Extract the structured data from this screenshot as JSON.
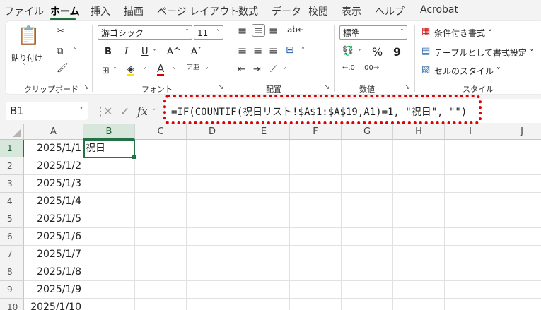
{
  "menu_tabs": [
    "ファイル",
    "ホーム",
    "挿入",
    "描画",
    "ページ レイアウト",
    "数式",
    "データ",
    "校閲",
    "表示",
    "ヘルプ",
    "Acrobat"
  ],
  "active_tab": "ホーム",
  "ribbon": {
    "clipboard": {
      "paste_label": "貼り付け",
      "group_label": "クリップボード"
    },
    "font": {
      "font_name": "游ゴシック",
      "font_size": "11",
      "bold": "B",
      "italic": "I",
      "underline": "U",
      "grow": "A^",
      "shrink": "Aˇ",
      "group_label": "フォント"
    },
    "alignment": {
      "group_label": "配置"
    },
    "number": {
      "format": "標準",
      "percent": "%",
      "comma": "9",
      "group_label": "数値"
    },
    "styles": {
      "conditional": "条件付き書式 ˅",
      "table": "テーブルとして書式設定 ˅",
      "cell_style": "セルのスタイル ˅",
      "group_label": "スタイル"
    }
  },
  "formula_bar": {
    "name_box": "B1",
    "fx": "fx",
    "formula": "=IF(COUNTIF(祝日リスト!$A$1:$A$19,A1)=1, \"祝日\", \"\")"
  },
  "grid": {
    "columns": [
      "A",
      "B",
      "C",
      "D",
      "E",
      "F",
      "G",
      "H",
      "I",
      "J"
    ],
    "selected_column": "B",
    "rows": [
      {
        "num": "1",
        "A": "2025/1/1",
        "B": "祝日"
      },
      {
        "num": "2",
        "A": "2025/1/2",
        "B": ""
      },
      {
        "num": "3",
        "A": "2025/1/3",
        "B": ""
      },
      {
        "num": "4",
        "A": "2025/1/4",
        "B": ""
      },
      {
        "num": "5",
        "A": "2025/1/5",
        "B": ""
      },
      {
        "num": "6",
        "A": "2025/1/6",
        "B": ""
      },
      {
        "num": "7",
        "A": "2025/1/7",
        "B": ""
      },
      {
        "num": "8",
        "A": "2025/1/8",
        "B": ""
      },
      {
        "num": "9",
        "A": "2025/1/9",
        "B": ""
      },
      {
        "num": "10",
        "A": "2025/1/10",
        "B": ""
      }
    ]
  },
  "colors": {
    "accent": "#217346",
    "highlight_border": "#e00000"
  }
}
